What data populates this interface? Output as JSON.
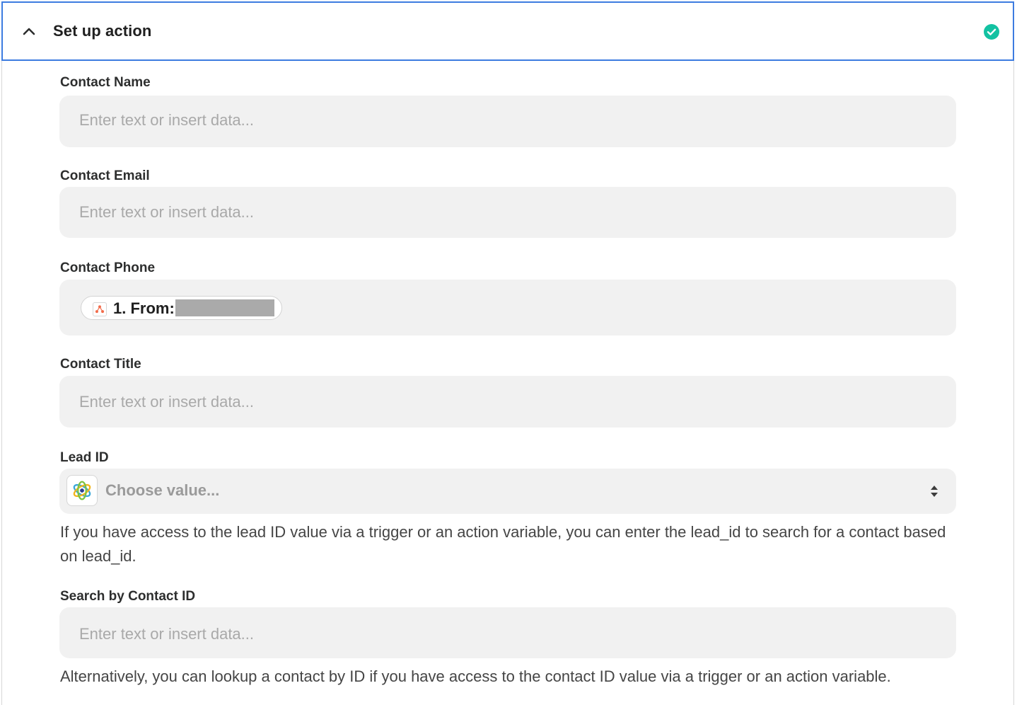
{
  "header": {
    "title": "Set up action",
    "expanded": true,
    "status": "complete"
  },
  "fields": {
    "contact_name": {
      "label": "Contact Name",
      "placeholder": "Enter text or insert data..."
    },
    "contact_email": {
      "label": "Contact Email",
      "placeholder": "Enter text or insert data..."
    },
    "contact_phone": {
      "label": "Contact Phone",
      "token_text": "1. From:"
    },
    "contact_title": {
      "label": "Contact Title",
      "placeholder": "Enter text or insert data..."
    },
    "lead_id": {
      "label": "Lead ID",
      "placeholder": "Choose value...",
      "help": "If you have access to the lead ID value via a trigger or an action variable, you can enter the lead_id to search for a contact based on lead_id."
    },
    "search_by_contact_id": {
      "label": "Search by Contact ID",
      "placeholder": "Enter text or insert data...",
      "help": "Alternatively, you can lookup a contact by ID if you have access to the contact ID value via a trigger or an action variable."
    }
  },
  "colors": {
    "accent_border": "#3d7ce0",
    "success": "#13c2a2",
    "field_bg": "#f1f1f1",
    "token_icon": "#f26b4a"
  },
  "icons": {
    "collapse": "chevron-up-icon",
    "status": "check-circle-icon",
    "token_app": "app-token-icon",
    "lead_app": "app-logo-icon",
    "select_arrows": "updown-arrows-icon"
  }
}
